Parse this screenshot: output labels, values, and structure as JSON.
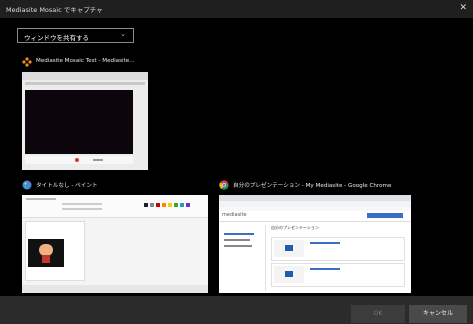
{
  "window": {
    "title": "Mediasite Mosaic でキャプチャ",
    "close_glyph": "✕"
  },
  "share_select": {
    "value": "ウィンドウを共有する",
    "chevron": "⌄"
  },
  "windows": [
    {
      "label": "Mediasite Mosaic Test - Mediasite..."
    },
    {
      "label": "タイトルなし - ペイント"
    },
    {
      "label": "自分のプレゼンテーション - My Mediasite - Google Chrome"
    }
  ],
  "thumb3": {
    "brand": "mediasite",
    "heading": "自分のプレゼンテーション"
  },
  "buttons": {
    "ok": "OK",
    "cancel": "キャンセル"
  }
}
